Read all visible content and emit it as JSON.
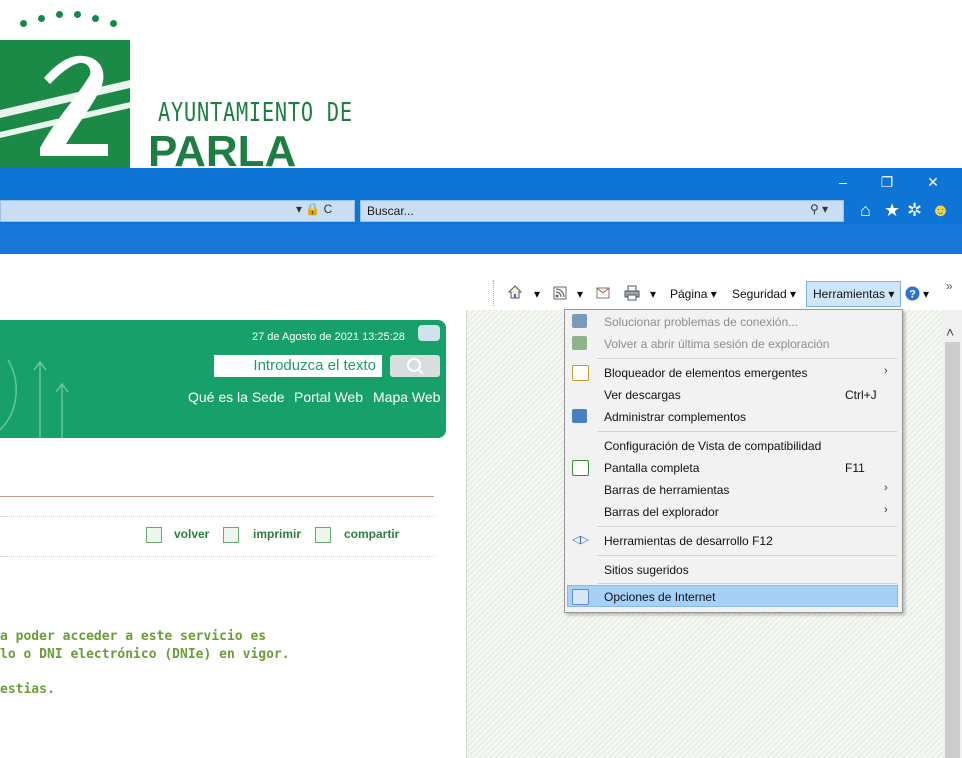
{
  "logo": {
    "line1": "AYUNTAMIENTO DE",
    "line2": "PARLA"
  },
  "browser": {
    "address_icons": "▾ 🔒 C",
    "search_placeholder": "Buscar...",
    "search_dropdown": "⚲ ▾",
    "window_controls": {
      "minimize": "–",
      "restore": "❐",
      "close": "✕"
    },
    "right_icons": [
      "home-icon",
      "star-icon",
      "gear-icon",
      "smiley-icon"
    ]
  },
  "command_bar": {
    "home_label": "▾",
    "feeds_label": "▾",
    "print_label": "▾",
    "pagina": "Página ▾",
    "seguridad": "Seguridad ▾",
    "herramientas": "Herramientas ▾",
    "help_label": "▾",
    "overflow": "»"
  },
  "page": {
    "datetime": "27 de Agosto de 2021 13:25:28",
    "search_placeholder": "Introduzca el texto",
    "header_links": [
      "Qué es la Sede",
      "Portal Web",
      "Mapa Web"
    ],
    "utilities": [
      "volver",
      "imprimir",
      "compartir"
    ],
    "body_lines": [
      "a poder acceder a este servicio es",
      "lo o DNI electrónico (DNIe) en vigor.",
      "estias."
    ]
  },
  "menu": {
    "items": [
      {
        "label": "Solucionar problemas de conexión...",
        "disabled": true
      },
      {
        "label": "Volver a abrir última sesión de exploración",
        "disabled": true
      },
      {
        "label": "Bloqueador de elementos emergentes",
        "arrow": "›"
      },
      {
        "label": "Ver descargas",
        "shortcut": "Ctrl+J"
      },
      {
        "label": "Administrar complementos"
      },
      {
        "label": "Configuración de Vista de compatibilidad"
      },
      {
        "label": "Pantalla completa",
        "shortcut": "F11"
      },
      {
        "label": "Barras de herramientas",
        "arrow": "›"
      },
      {
        "label": "Barras del explorador",
        "arrow": "›"
      },
      {
        "label": "Herramientas de desarrollo F12"
      },
      {
        "label": "Sitios sugeridos"
      },
      {
        "label": "Opciones de Internet",
        "highlighted": true
      }
    ]
  }
}
